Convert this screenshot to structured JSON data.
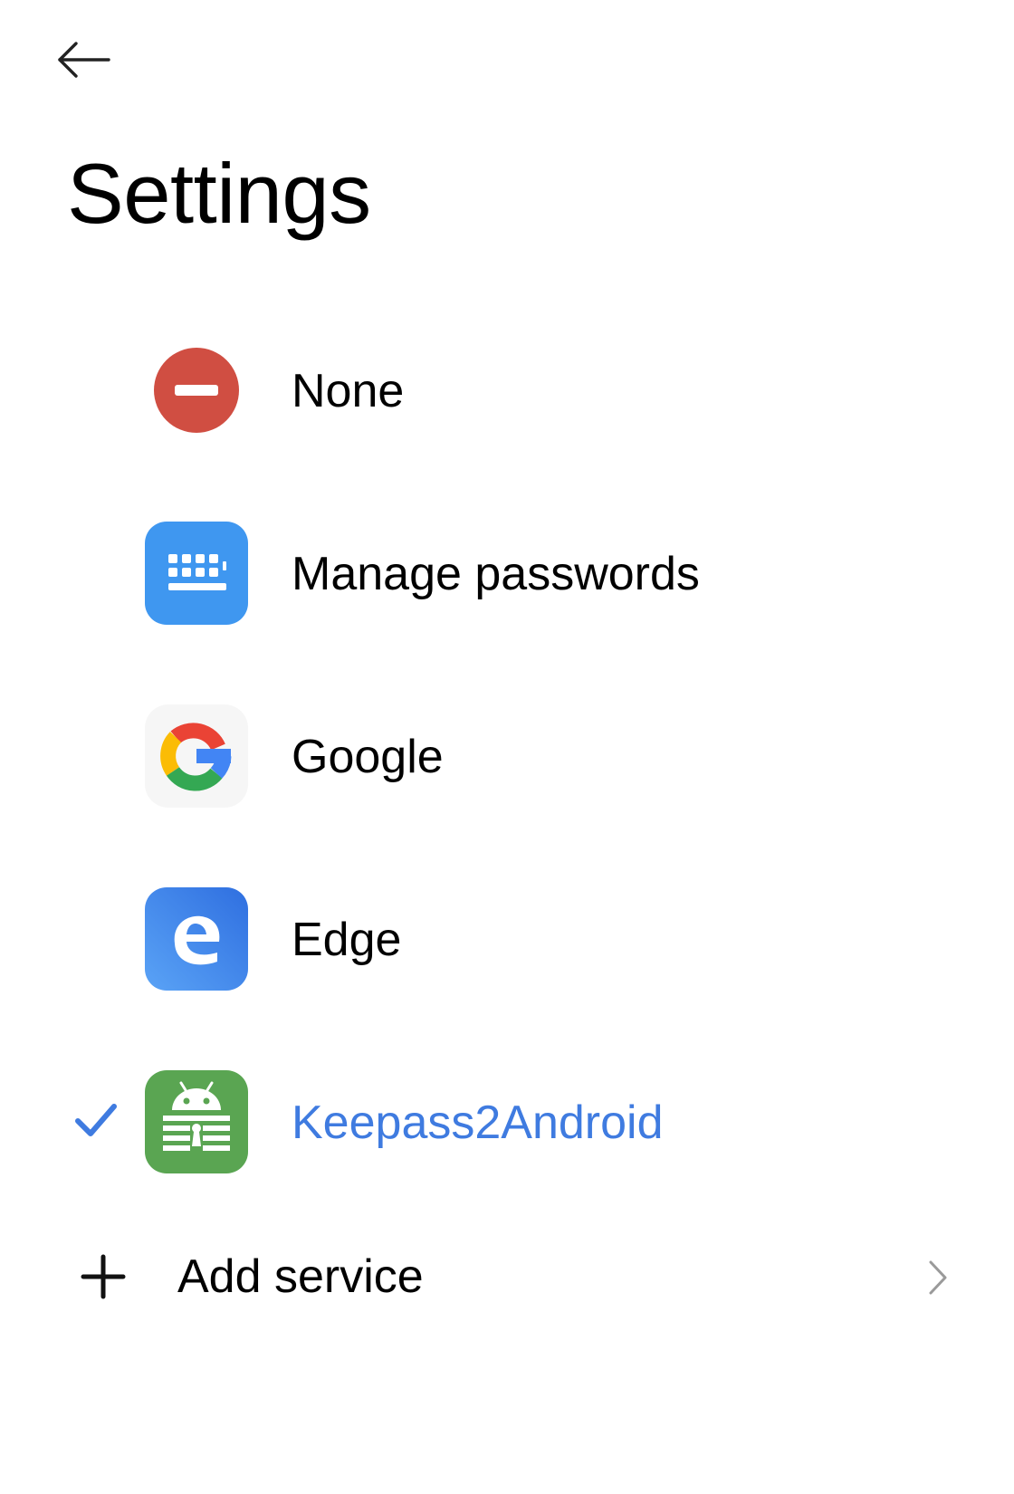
{
  "header": {
    "title": "Settings",
    "back_icon": "arrow-left-icon"
  },
  "services": [
    {
      "label": "None",
      "icon": "no-entry-icon",
      "selected": false
    },
    {
      "label": "Manage passwords",
      "icon": "keyboard-icon",
      "selected": false
    },
    {
      "label": "Google",
      "icon": "google-logo-icon",
      "selected": false
    },
    {
      "label": "Edge",
      "icon": "edge-logo-icon",
      "selected": false
    },
    {
      "label": "Keepass2Android",
      "icon": "keepass2android-logo-icon",
      "selected": true
    }
  ],
  "add_service": {
    "label": "Add service",
    "icon": "plus-icon",
    "trailing_icon": "chevron-right-icon"
  },
  "colors": {
    "accent": "#3f7be0",
    "none_red": "#d04e42",
    "keyboard_blue": "#3f97f0",
    "keepass_green": "#5aa552"
  }
}
